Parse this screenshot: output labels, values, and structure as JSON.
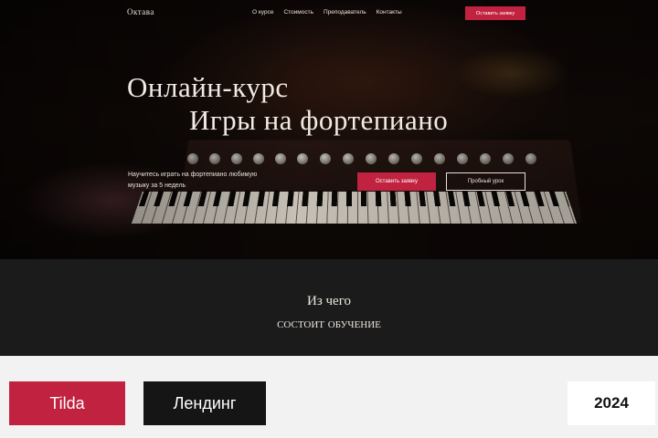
{
  "header": {
    "logo": "Октава",
    "menu": [
      "О курсе",
      "Стоимость",
      "Преподаватель",
      "Контакты"
    ],
    "cta": "Оставить заявку"
  },
  "hero": {
    "title_line1": "Онлайн-курс",
    "title_line2": "Игры на фортепиано",
    "subtitle": "Научитесь играть на фортепиано любимую музыку за 5 недель",
    "primary_button": "Оставить заявку",
    "secondary_button": "Пробный урок"
  },
  "section": {
    "title_line1": "Из чего",
    "title_line2": "состоит обучение"
  },
  "badges": {
    "platform": "Tilda",
    "type": "Лендинг",
    "year": "2024"
  },
  "colors": {
    "accent": "#c0223f",
    "dark": "#1b1b1b",
    "light_bg": "#f2f2f2"
  }
}
